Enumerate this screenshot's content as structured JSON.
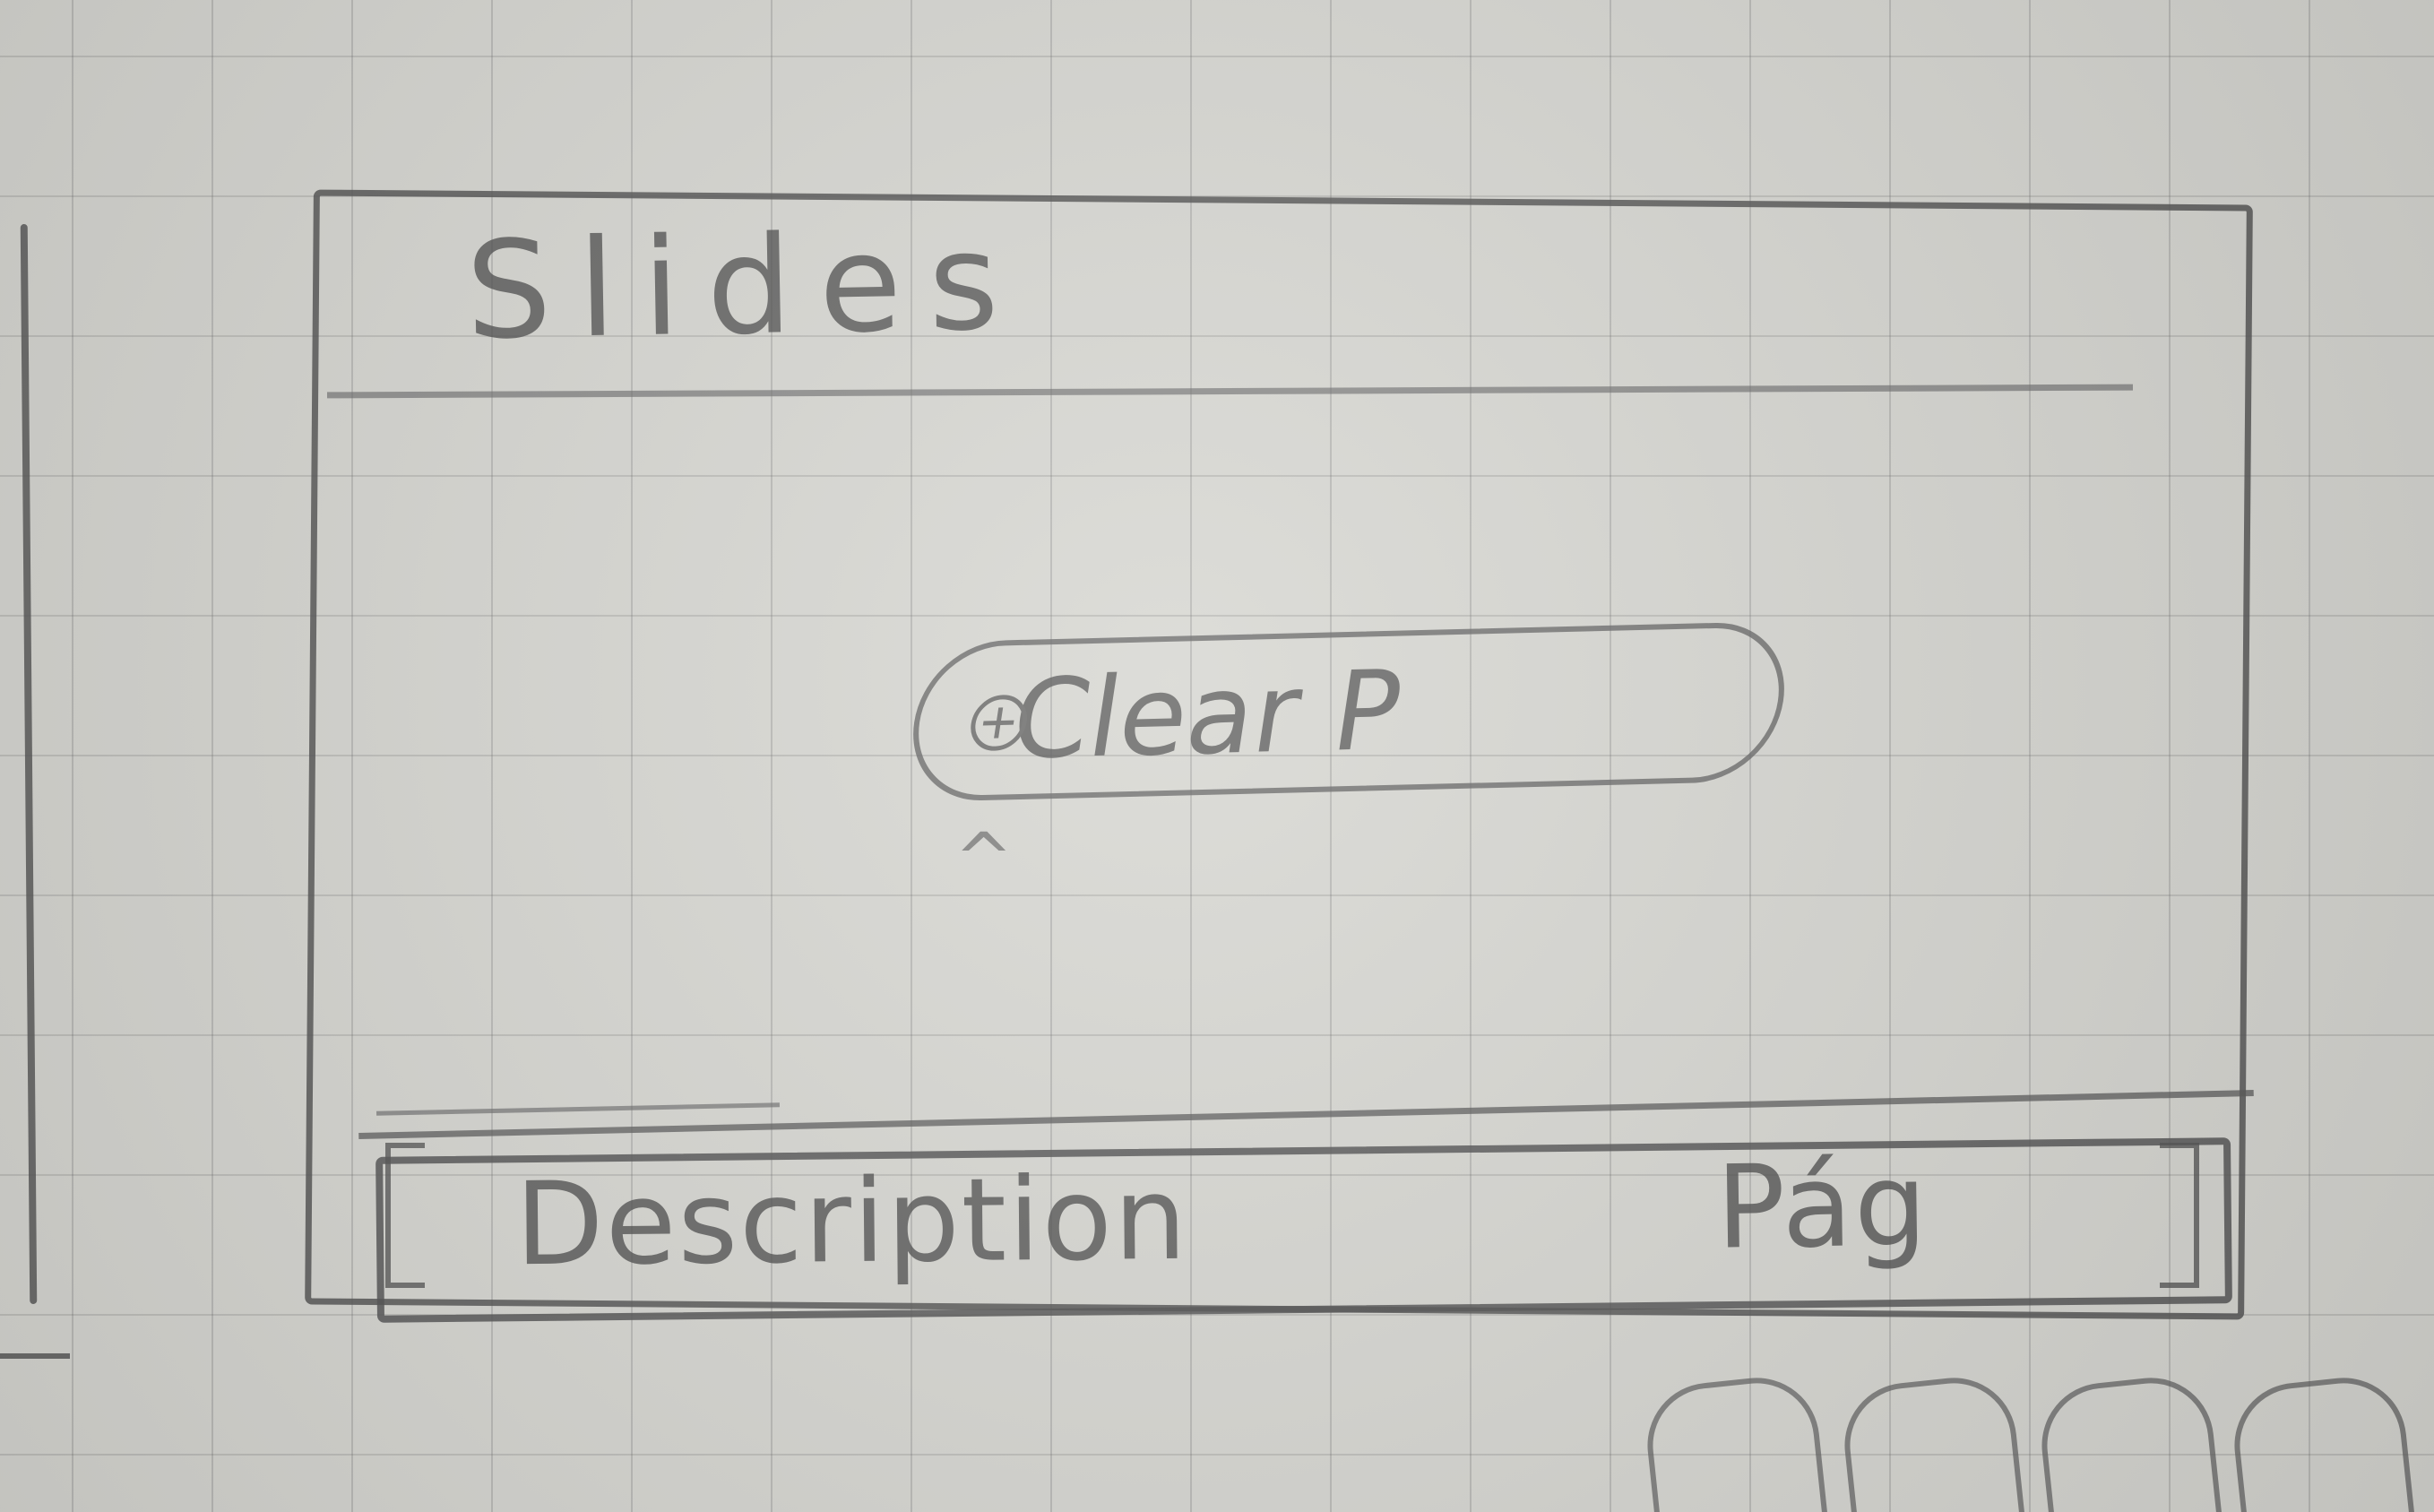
{
  "sketch": {
    "header": {
      "title": "Slides"
    },
    "content": {
      "button_label": "Clear P",
      "caret": "^"
    },
    "footer": {
      "description": "Description",
      "page": "Pág"
    }
  }
}
